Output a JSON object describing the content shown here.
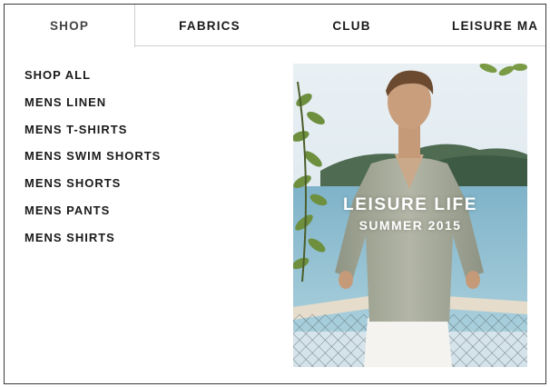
{
  "nav": {
    "tabs": [
      {
        "label": "SHOP"
      },
      {
        "label": "FABRICS"
      },
      {
        "label": "CLUB"
      },
      {
        "label": "LEISURE MA"
      }
    ]
  },
  "menu": {
    "items": [
      {
        "label": "SHOP ALL"
      },
      {
        "label": "MENS LINEN"
      },
      {
        "label": "MENS T-SHIRTS"
      },
      {
        "label": "MENS SWIM SHORTS"
      },
      {
        "label": "MENS SHORTS"
      },
      {
        "label": "MENS PANTS"
      },
      {
        "label": "MENS SHIRTS"
      }
    ]
  },
  "promo": {
    "title": "LEISURE LIFE",
    "subtitle": "SUMMER 2015"
  }
}
